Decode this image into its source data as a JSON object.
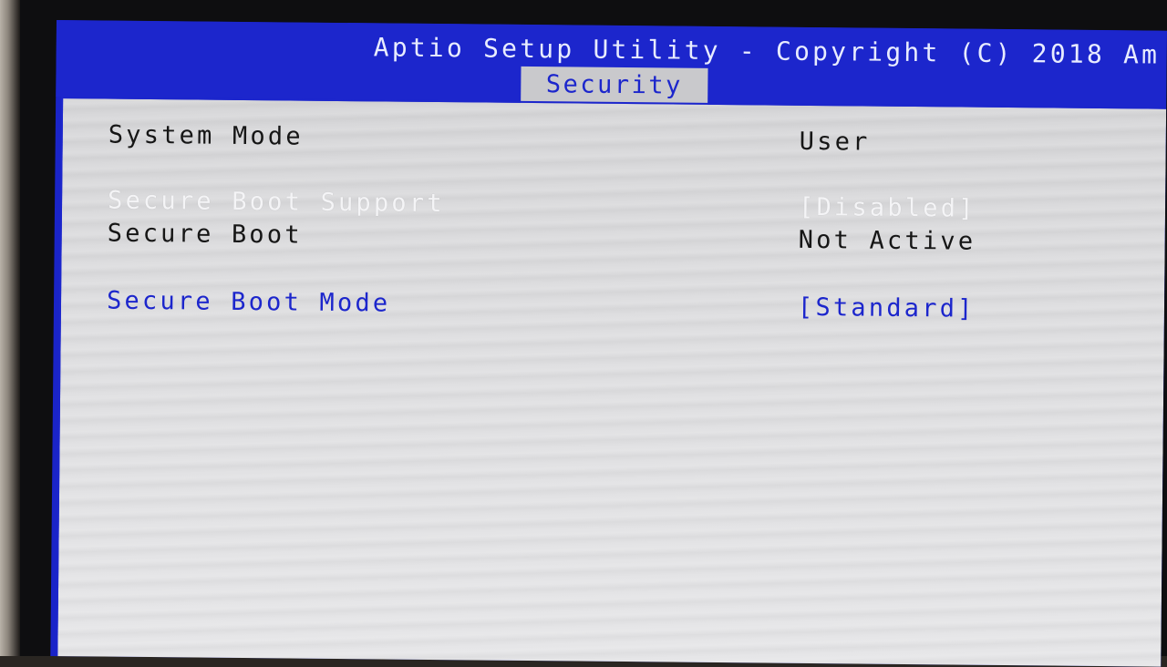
{
  "header": {
    "title": "Aptio Setup Utility - Copyright (C) 2018 Am"
  },
  "tabs": [
    {
      "label": "Security",
      "active": true
    }
  ],
  "settings": {
    "system_mode": {
      "label": "System Mode",
      "value": "User"
    },
    "secure_boot_support": {
      "label": "Secure Boot Support",
      "value": "[Disabled]"
    },
    "secure_boot": {
      "label": "Secure Boot",
      "value": "Not Active"
    },
    "secure_boot_mode": {
      "label": "Secure Boot Mode",
      "value": "[Standard]"
    }
  },
  "colors": {
    "title_bar": "#1c26cc",
    "content_bg": "#dedee0",
    "selectable_text": "#1c26cc",
    "static_text": "#161616",
    "disabled_text": "#f4f4f6"
  }
}
